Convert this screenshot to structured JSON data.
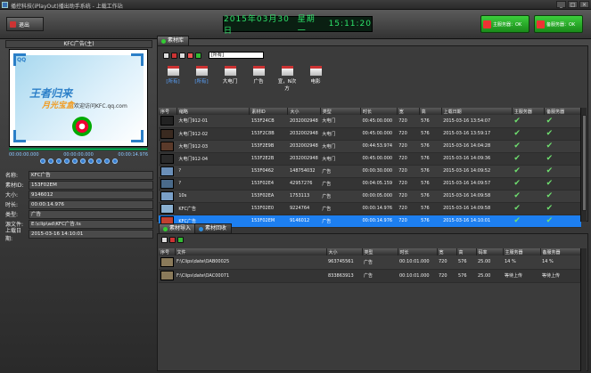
{
  "window": {
    "title": "播控科技(iPlayOut)播出助手系统 - 上载工作站",
    "buttons": [
      "_",
      "□",
      "×"
    ]
  },
  "toolbar": {
    "exit_label": "退出",
    "date": "2015年03月30日",
    "weekday": "星期一",
    "time": "15:11:20",
    "main_server": "主服务器：OK",
    "backup_server": "备服务器：OK"
  },
  "player": {
    "header": "KFC广告(主)",
    "logo_text": "王者归来",
    "logo_text2": "月光宝盒",
    "site_text": "欢迎访问KFC.qq.com",
    "corner_text": "QQ",
    "time_start": "00:00:00.000",
    "time_mid": "00:00:00.000",
    "time_end": "00:00:14.976"
  },
  "info": [
    {
      "label": "名称:",
      "value": "KFC广告"
    },
    {
      "label": "素材ID:",
      "value": "153F02EM"
    },
    {
      "label": "大小:",
      "value": "9146012"
    },
    {
      "label": "时长:",
      "value": "00:00:14.976"
    },
    {
      "label": "类型:",
      "value": "广告"
    },
    {
      "label": "源文件:",
      "value": "E:\\clip\\ad\\KFC广告.ts"
    },
    {
      "label": "上载日期:",
      "value": "2015-03-16 14:10:01"
    }
  ],
  "material_tab": "素材库",
  "search_value": "[所有]",
  "categories": [
    {
      "label": "[所有]",
      "selected": true
    },
    {
      "label": "[所有]",
      "selected": true
    },
    {
      "label": "大电门",
      "selected": false
    },
    {
      "label": "广告",
      "selected": false
    },
    {
      "label": "宣，N次方",
      "selected": false
    },
    {
      "label": "电影",
      "selected": false
    }
  ],
  "columns": [
    "序号",
    "缩略",
    "素材ID",
    "大小",
    "类型",
    "时长",
    "宽",
    "高",
    "上载日期",
    "主服务器",
    "备服务器"
  ],
  "rows": [
    {
      "name": "大电门912-01",
      "id": "153F24CB",
      "size": "2032002948",
      "type": "大电门",
      "dur": "00:45:00.000",
      "w": "720",
      "h": "576",
      "date": "2015-03-16 13:54:07",
      "thumb": "#222"
    },
    {
      "name": "大电门912-02",
      "id": "153F2C8B",
      "size": "2032002948",
      "type": "大电门",
      "dur": "00:45:00.000",
      "w": "720",
      "h": "576",
      "date": "2015-03-16 13:59:17",
      "thumb": "#3a2a20"
    },
    {
      "name": "大电门912-03",
      "id": "153F2E9B",
      "size": "2032002948",
      "type": "大电门",
      "dur": "00:44:53.974",
      "w": "720",
      "h": "576",
      "date": "2015-03-16 14:04:28",
      "thumb": "#5a3a2a"
    },
    {
      "name": "大电门912-04",
      "id": "153F2E2B",
      "size": "2032002948",
      "type": "大电门",
      "dur": "00:45:00.000",
      "w": "720",
      "h": "576",
      "date": "2015-03-16 14:09:36",
      "thumb": "#2a2a2a"
    },
    {
      "name": "?",
      "id": "153F0462",
      "size": "148754032",
      "type": "广告",
      "dur": "00:00:30.000",
      "w": "720",
      "h": "576",
      "date": "2015-03-16 14:09:52",
      "thumb": "#6a8fb8"
    },
    {
      "name": "?",
      "id": "153F02E4",
      "size": "42957276",
      "type": "广告",
      "dur": "00:04:05.159",
      "w": "720",
      "h": "576",
      "date": "2015-03-16 14:09:57",
      "thumb": "#4a6a8a"
    },
    {
      "name": "10s",
      "id": "153F02EA",
      "size": "1753113",
      "type": "广告",
      "dur": "00:00:05.000",
      "w": "720",
      "h": "576",
      "date": "2015-03-16 14:09:58",
      "thumb": "#7aa0c8"
    },
    {
      "name": "KFC广告",
      "id": "153F02E0",
      "size": "9224764",
      "type": "广告",
      "dur": "00:00:14.976",
      "w": "720",
      "h": "576",
      "date": "2015-03-16 14:09:58",
      "thumb": "#8ab0d0"
    },
    {
      "name": "KFC广告",
      "id": "153F02EM",
      "size": "9146012",
      "type": "广告",
      "dur": "00:00:14.976",
      "w": "720",
      "h": "576",
      "date": "2015-03-16 14:10:01",
      "thumb": "#c04030",
      "selected": true
    }
  ],
  "upload_tabs": [
    "素材导入",
    "素材回收"
  ],
  "upload_columns": [
    "序号",
    "文件",
    "大小",
    "类型",
    "时长",
    "宽",
    "高",
    "码率",
    "主服务器",
    "备服务器"
  ],
  "upload_rows": [
    {
      "file": "F:\\Clips\\date\\OAB00025",
      "size": "963745561",
      "type": "广告",
      "dur": "00:10:01.000",
      "w": "720",
      "h": "576",
      "rate": "25.00",
      "main": "14 %",
      "backup": "14 %"
    },
    {
      "file": "F:\\Clips\\date\\OAC00071",
      "size": "833863913",
      "type": "广告",
      "dur": "00:10:01.000",
      "w": "720",
      "h": "576",
      "rate": "25.00",
      "main": "等待上传",
      "backup": "等待上传"
    }
  ]
}
